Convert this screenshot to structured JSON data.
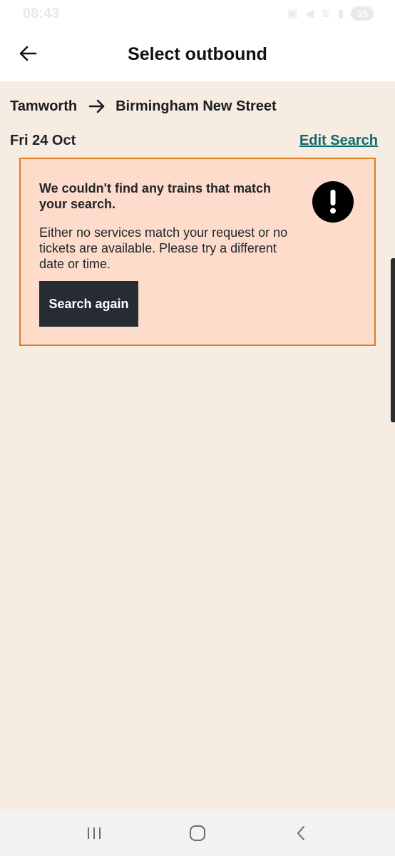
{
  "status_bar": {
    "time": "08:43",
    "battery": "35"
  },
  "header": {
    "title": "Select outbound"
  },
  "journey": {
    "origin": "Tamworth",
    "destination": "Birmingham New Street",
    "date": "Fri 24 Oct",
    "edit_search_label": "Edit Search"
  },
  "alert": {
    "heading": "We couldn't find any trains that match your search.",
    "body": "Either no services match your request or no tickets are available. Please try a different date or time.",
    "button_label": "Search again",
    "icon": "exclamation-icon"
  },
  "colors": {
    "background": "#f6ece1",
    "alert_background": "#fddccb",
    "alert_border": "#e07b22",
    "link": "#0d6b6e",
    "button": "#252c34"
  },
  "nav_bar": {
    "icons": [
      "recents-icon",
      "home-icon",
      "back-nav-icon"
    ]
  }
}
